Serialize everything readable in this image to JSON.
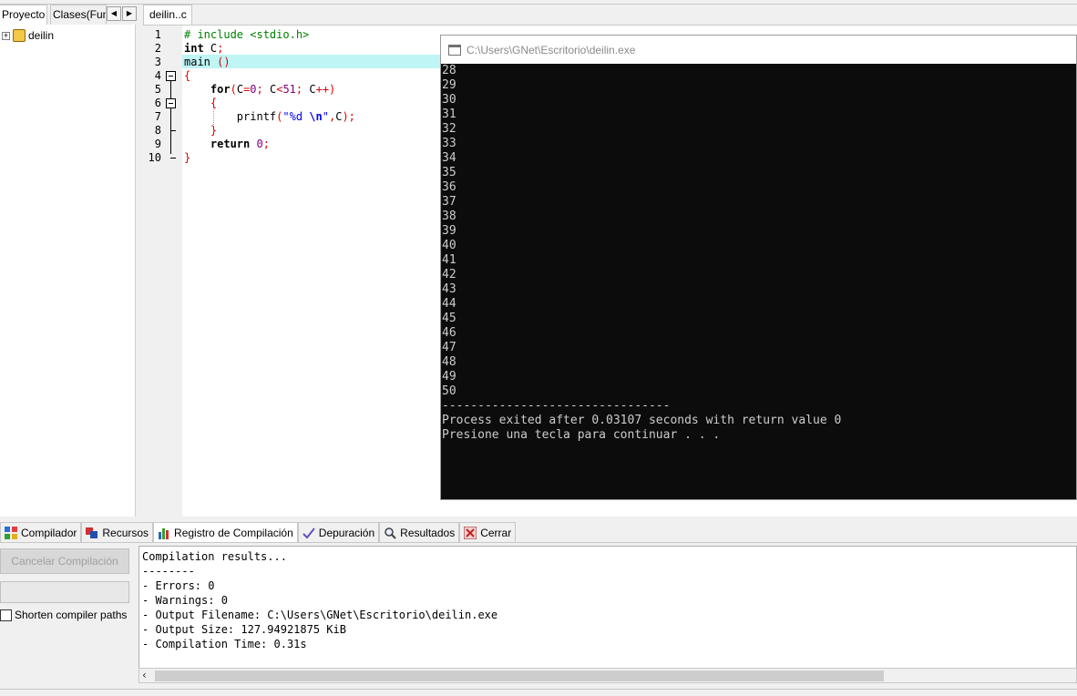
{
  "left_panel": {
    "tabs": [
      "Proyecto",
      "Clases(Fun"
    ],
    "tree": {
      "project_name": "deilin"
    }
  },
  "editor": {
    "tab_label": "deilin..c",
    "line_numbers": [
      "1",
      "2",
      "3",
      "4",
      "5",
      "6",
      "7",
      "8",
      "9",
      "10"
    ]
  },
  "console": {
    "title": "C:\\Users\\GNet\\Escritorio\\deilin.exe",
    "output_lines": [
      "28",
      "29",
      "30",
      "31",
      "32",
      "33",
      "34",
      "35",
      "36",
      "37",
      "38",
      "39",
      "40",
      "41",
      "42",
      "43",
      "44",
      "45",
      "46",
      "47",
      "48",
      "49",
      "50"
    ],
    "separator": "--------------------------------",
    "exit_message": "Process exited after 0.03107 seconds with return value 0",
    "continue_prompt": "Presione una tecla para continuar . . ."
  },
  "bottom_tabs": [
    "Compilador",
    "Recursos",
    "Registro de Compilación",
    "Depuración",
    "Resultados",
    "Cerrar"
  ],
  "bottom_panel": {
    "cancel_button": "Cancelar Compilación",
    "shorten_label": "Shorten compiler paths",
    "log_lines": [
      "Compilation results...",
      "--------",
      "- Errors: 0",
      "- Warnings: 0",
      "- Output Filename: C:\\Users\\GNet\\Escritorio\\deilin.exe",
      "- Output Size: 127.94921875 KiB",
      "- Compilation Time: 0.31s"
    ]
  }
}
